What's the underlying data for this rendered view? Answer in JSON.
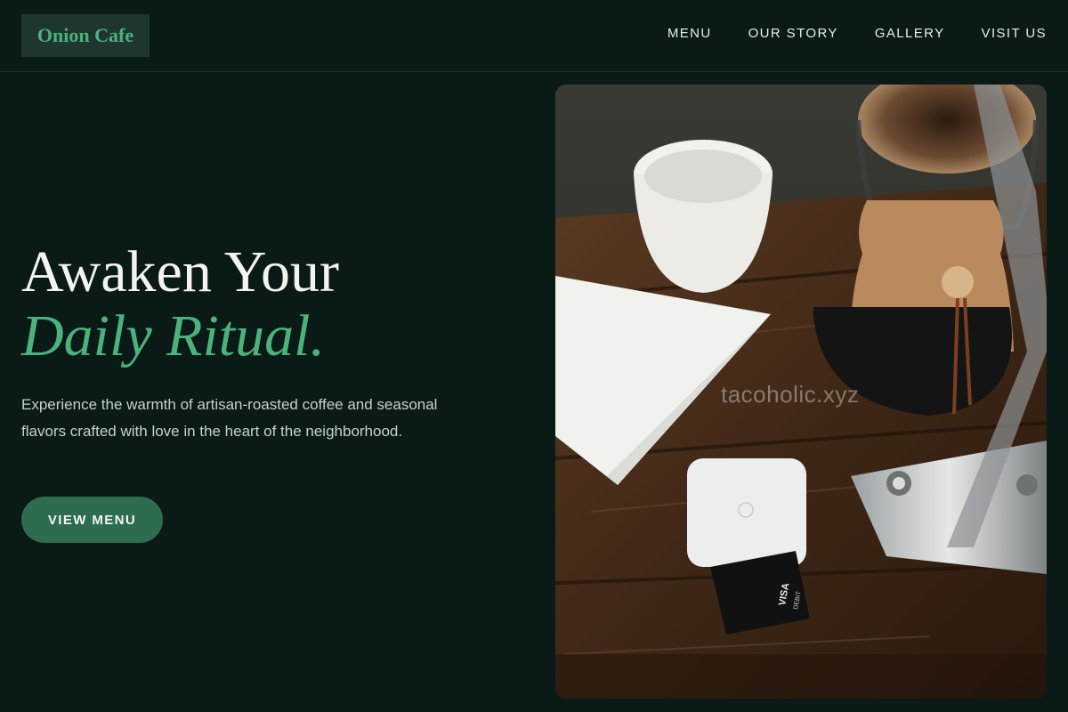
{
  "header": {
    "logo": "Onion Cafe",
    "nav": [
      "MENU",
      "OUR STORY",
      "GALLERY",
      "VISIT US"
    ]
  },
  "hero": {
    "title_line1": "Awaken Your",
    "title_line2": "Daily Ritual.",
    "description": "Experience the warmth of artisan-roasted coffee and seasonal flavors crafted with love in the heart of the neighborhood.",
    "cta": "VIEW MENU"
  },
  "photo": {
    "watermark": "tacoholic.xyz",
    "card_brand": "VISA",
    "card_type": "DEBIT"
  },
  "colors": {
    "background": "#0a1a16",
    "accent": "#4cb27c",
    "button": "#2d6c4e",
    "logo_bg": "#1e3530"
  }
}
